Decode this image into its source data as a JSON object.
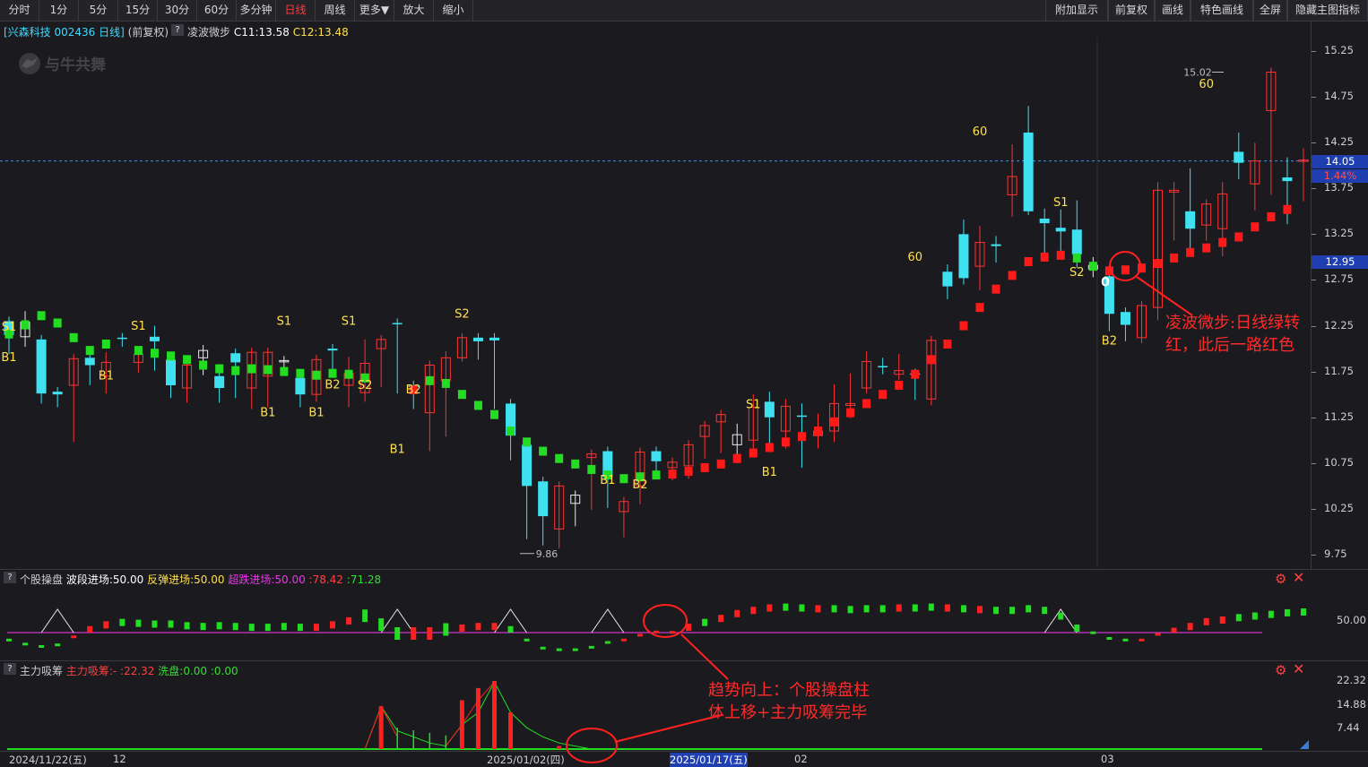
{
  "toolbar": {
    "left": [
      "分时",
      "1分",
      "5分",
      "15分",
      "30分",
      "60分",
      "多分钟",
      "日线",
      "周线",
      "更多▼",
      "放大",
      "缩小"
    ],
    "right": [
      "附加显示",
      "前复权",
      "画线",
      "特色画线",
      "全屏",
      "隐藏主图指标"
    ],
    "active": "日线"
  },
  "header": {
    "stock": "[兴森科技 002436 日线]",
    "adjust": "(前复权)",
    "q": "?",
    "indicator": "凌波微步",
    "c1": "C11:13.58",
    "c2": "C12:13.48"
  },
  "watermark": "与牛共舞",
  "price_axis": {
    "ticks": [
      "15.25",
      "14.75",
      "14.25",
      "13.75",
      "13.25",
      "12.75",
      "12.25",
      "11.75",
      "11.25",
      "10.75",
      "10.25",
      "9.75"
    ],
    "current_price": "14.05",
    "current_pct": "1.44%",
    "cursor_price": "12.95"
  },
  "chart_data": {
    "type": "candlestick",
    "ylim": [
      9.6,
      15.5
    ],
    "high_label": "15.02",
    "low_label": "9.86",
    "candles": [
      [
        12.3,
        12.15,
        12.05,
        11.98,
        "cyan"
      ],
      [
        12.13,
        12.29,
        12.36,
        12.06,
        "none"
      ],
      [
        12.1,
        11.51,
        11.65,
        11.44,
        "cyan"
      ],
      [
        11.5,
        11.53,
        11.44,
        11.4,
        "cyan"
      ],
      [
        11.6,
        11.89,
        11.86,
        11.02,
        "red"
      ],
      [
        11.9,
        11.82,
        11.88,
        11.64,
        "cyan"
      ],
      [
        11.7,
        11.85,
        11.91,
        11.55,
        "red"
      ],
      [
        12.12,
        12.11,
        12.11,
        12.06,
        "cyan"
      ],
      [
        11.85,
        11.94,
        11.94,
        11.78,
        "red"
      ],
      [
        12.13,
        12.08,
        12.2,
        11.8,
        "cyan"
      ],
      [
        11.88,
        11.6,
        11.77,
        11.5,
        "cyan"
      ],
      [
        11.57,
        11.82,
        11.86,
        11.45,
        "red"
      ],
      [
        11.9,
        11.98,
        11.99,
        11.75,
        "none"
      ],
      [
        11.7,
        11.57,
        11.64,
        11.45,
        "cyan"
      ],
      [
        11.95,
        11.85,
        11.81,
        11.5,
        "cyan"
      ],
      [
        11.57,
        11.96,
        11.93,
        11.38,
        "red"
      ],
      [
        11.7,
        11.96,
        11.92,
        11.4,
        "red"
      ],
      [
        11.87,
        11.86,
        11.86,
        11.8,
        "none"
      ],
      [
        11.5,
        11.68,
        11.72,
        11.4,
        "cyan"
      ],
      [
        11.5,
        11.88,
        11.86,
        11.46,
        "red"
      ],
      [
        12.0,
        11.98,
        11.98,
        11.75,
        "cyan"
      ],
      [
        11.6,
        11.73,
        11.86,
        11.4,
        "red"
      ],
      [
        11.52,
        11.84,
        12.05,
        11.46,
        "red"
      ],
      [
        12.0,
        12.1,
        12.09,
        11.62,
        "red"
      ],
      [
        12.27,
        12.28,
        12.04,
        11.55,
        "cyan"
      ],
      [
        11.58,
        11.6,
        11.52,
        11.38,
        "cyan"
      ],
      [
        11.3,
        11.82,
        11.76,
        10.92,
        "red"
      ],
      [
        11.65,
        11.9,
        11.92,
        11.08,
        "red"
      ],
      [
        11.9,
        12.12,
        12.1,
        12.0,
        "red"
      ],
      [
        12.08,
        12.12,
        12.08,
        11.92,
        "cyan"
      ],
      [
        12.12,
        12.09,
        12.09,
        11.38,
        "cyan"
      ],
      [
        11.4,
        11.05,
        11.02,
        10.82,
        "cyan"
      ],
      [
        10.95,
        10.5,
        10.52,
        9.96,
        "cyan"
      ],
      [
        10.55,
        10.17,
        10.0,
        9.89,
        "cyan"
      ],
      [
        10.5,
        10.03,
        10.45,
        9.86,
        "red"
      ],
      [
        10.4,
        10.31,
        10.32,
        10.1,
        "none"
      ],
      [
        10.85,
        10.81,
        10.81,
        10.28,
        "red"
      ],
      [
        10.6,
        10.88,
        10.62,
        10.3,
        "cyan"
      ],
      [
        10.22,
        10.33,
        10.13,
        9.98,
        "red"
      ],
      [
        10.5,
        10.87,
        10.79,
        10.34,
        "red"
      ],
      [
        10.88,
        10.77,
        10.72,
        10.64,
        "cyan"
      ],
      [
        10.7,
        10.76,
        10.72,
        10.6,
        "red"
      ],
      [
        10.95,
        10.72,
        10.92,
        10.62,
        "red"
      ],
      [
        11.16,
        11.04,
        11.05,
        10.84,
        "red"
      ],
      [
        11.2,
        11.28,
        11.28,
        10.9,
        "red"
      ],
      [
        10.95,
        11.06,
        11.13,
        10.79,
        "none"
      ],
      [
        11.0,
        11.36,
        11.45,
        10.95,
        "red"
      ],
      [
        11.25,
        11.42,
        11.48,
        11.0,
        "cyan"
      ],
      [
        11.1,
        11.37,
        11.4,
        10.95,
        "red"
      ],
      [
        11.26,
        11.27,
        11.35,
        10.74,
        "cyan"
      ],
      [
        11.1,
        11.05,
        11.24,
        10.95,
        "red"
      ],
      [
        11.1,
        11.4,
        11.56,
        11.02,
        "red"
      ],
      [
        11.4,
        11.38,
        11.68,
        11.28,
        "red"
      ],
      [
        11.57,
        11.86,
        11.92,
        11.55,
        "red"
      ],
      [
        11.8,
        11.81,
        11.85,
        11.76,
        "cyan"
      ],
      [
        11.76,
        11.72,
        11.89,
        11.7,
        "red"
      ],
      [
        11.73,
        11.73,
        11.73,
        11.48,
        "cyan"
      ],
      [
        11.45,
        12.09,
        12.09,
        11.42,
        "red"
      ],
      [
        12.68,
        12.84,
        12.87,
        12.58,
        "cyan"
      ],
      [
        12.77,
        13.25,
        13.36,
        12.74,
        "cyan"
      ],
      [
        12.9,
        13.16,
        13.29,
        12.68,
        "red"
      ],
      [
        13.12,
        13.14,
        13.18,
        12.98,
        "cyan"
      ],
      [
        13.68,
        13.88,
        14.18,
        13.48,
        "red"
      ],
      [
        13.5,
        14.36,
        14.6,
        13.78,
        "cyan"
      ],
      [
        13.42,
        13.37,
        13.48,
        13.05,
        "cyan"
      ],
      [
        13.28,
        13.32,
        13.47,
        13.09,
        "cyan"
      ],
      [
        13.3,
        13.03,
        13.57,
        12.92,
        "cyan"
      ],
      [
        12.87,
        12.91,
        12.95,
        12.82,
        "none"
      ],
      [
        12.79,
        12.38,
        12.43,
        12.23,
        "cyan"
      ],
      [
        12.4,
        12.26,
        12.3,
        12.12,
        "cyan"
      ],
      [
        12.12,
        12.47,
        12.44,
        12.1,
        "red"
      ],
      [
        12.45,
        13.73,
        13.77,
        12.35,
        "red"
      ],
      [
        13.73,
        13.71,
        13.77,
        13.22,
        "red"
      ],
      [
        13.5,
        13.31,
        13.92,
        13.05,
        "cyan"
      ],
      [
        13.58,
        13.35,
        13.46,
        13.22,
        "red"
      ],
      [
        13.31,
        13.69,
        13.77,
        13.05,
        "red"
      ],
      [
        14.15,
        14.03,
        14.31,
        13.89,
        "cyan"
      ],
      [
        13.8,
        14.05,
        14.2,
        13.55,
        "red"
      ],
      [
        14.6,
        15.02,
        15.02,
        13.72,
        "red"
      ],
      [
        13.83,
        13.87,
        14.04,
        13.4,
        "cyan"
      ],
      [
        14.05,
        14.06,
        14.14,
        13.65,
        "red"
      ]
    ],
    "trail": [
      [
        0,
        12.16,
        "green"
      ],
      [
        1,
        12.26,
        "green"
      ],
      [
        2,
        12.36,
        "green"
      ],
      [
        3,
        12.28,
        "green"
      ],
      [
        4,
        12.12,
        "green"
      ],
      [
        5,
        11.98,
        "green"
      ],
      [
        6,
        12.05,
        "green"
      ],
      [
        8,
        11.98,
        "green"
      ],
      [
        9,
        11.95,
        "green"
      ],
      [
        10,
        11.92,
        "green"
      ],
      [
        11,
        11.88,
        "green"
      ],
      [
        12,
        11.82,
        "green"
      ],
      [
        13,
        11.78,
        "green"
      ],
      [
        14,
        11.76,
        "green"
      ],
      [
        15,
        11.78,
        "green"
      ],
      [
        16,
        11.77,
        "green"
      ],
      [
        17,
        11.75,
        "green"
      ],
      [
        18,
        11.73,
        "green"
      ],
      [
        19,
        11.71,
        "green"
      ],
      [
        20,
        11.73,
        "green"
      ],
      [
        21,
        11.72,
        "green"
      ],
      [
        22,
        11.68,
        "green"
      ],
      [
        25,
        11.55,
        "red"
      ],
      [
        26,
        11.65,
        "green"
      ],
      [
        27,
        11.62,
        "green"
      ],
      [
        28,
        11.5,
        "green"
      ],
      [
        29,
        11.38,
        "green"
      ],
      [
        30,
        11.28,
        "green"
      ],
      [
        31,
        11.1,
        "green"
      ],
      [
        32,
        10.98,
        "green"
      ],
      [
        33,
        10.88,
        "green"
      ],
      [
        34,
        10.8,
        "green"
      ],
      [
        35,
        10.74,
        "green"
      ],
      [
        36,
        10.68,
        "green"
      ],
      [
        37,
        10.62,
        "green"
      ],
      [
        38,
        10.58,
        "green"
      ],
      [
        39,
        10.6,
        "green"
      ],
      [
        40,
        10.62,
        "green"
      ],
      [
        41,
        10.63,
        "red"
      ],
      [
        42,
        10.66,
        "red"
      ],
      [
        43,
        10.7,
        "red"
      ],
      [
        44,
        10.74,
        "red"
      ],
      [
        45,
        10.8,
        "red"
      ],
      [
        46,
        10.86,
        "red"
      ],
      [
        47,
        10.92,
        "red"
      ],
      [
        48,
        10.98,
        "red"
      ],
      [
        49,
        11.04,
        "red"
      ],
      [
        50,
        11.1,
        "red"
      ],
      [
        51,
        11.2,
        "red"
      ],
      [
        52,
        11.3,
        "red"
      ],
      [
        53,
        11.4,
        "red"
      ],
      [
        54,
        11.5,
        "red"
      ],
      [
        55,
        11.6,
        "red"
      ],
      [
        56,
        11.72,
        "red"
      ],
      [
        57,
        11.88,
        "red"
      ],
      [
        58,
        12.05,
        "red"
      ],
      [
        59,
        12.25,
        "red"
      ],
      [
        60,
        12.45,
        "red"
      ],
      [
        61,
        12.65,
        "red"
      ],
      [
        62,
        12.8,
        "red"
      ],
      [
        63,
        12.95,
        "red"
      ],
      [
        64,
        13.0,
        "red"
      ],
      [
        65,
        13.02,
        "red"
      ],
      [
        66,
        12.99,
        "green"
      ],
      [
        67,
        12.9,
        "green"
      ],
      [
        68,
        12.85,
        "red"
      ],
      [
        69,
        12.86,
        "red"
      ],
      [
        70,
        12.88,
        "red"
      ],
      [
        71,
        12.93,
        "red"
      ],
      [
        72,
        12.99,
        "red"
      ],
      [
        73,
        13.05,
        "red"
      ],
      [
        74,
        13.1,
        "red"
      ],
      [
        75,
        13.16,
        "red"
      ],
      [
        76,
        13.22,
        "red"
      ],
      [
        77,
        13.33,
        "red"
      ],
      [
        78,
        13.44,
        "red"
      ],
      [
        79,
        13.52,
        "red"
      ]
    ],
    "marks": [
      [
        0,
        "S1",
        12.14,
        "above"
      ],
      [
        0,
        "B1",
        12.0,
        "below"
      ],
      [
        8,
        "S1",
        12.15,
        "above"
      ],
      [
        6,
        "B1",
        11.8,
        "below"
      ],
      [
        17,
        "S1",
        12.2,
        "above"
      ],
      [
        16,
        "B1",
        11.4,
        "below"
      ],
      [
        21,
        "S1",
        12.2,
        "above"
      ],
      [
        19,
        "B1",
        11.4,
        "below"
      ],
      [
        20,
        "B2",
        11.7,
        "below"
      ],
      [
        22,
        "S2",
        11.5,
        "above"
      ],
      [
        24,
        "B1",
        11.0,
        "below"
      ],
      [
        25,
        "B2",
        11.65,
        "below"
      ],
      [
        28,
        "S2",
        12.28,
        "above"
      ],
      [
        37,
        "B1",
        10.66,
        "below"
      ],
      [
        39,
        "B2",
        10.61,
        "below"
      ],
      [
        46,
        "S1",
        11.29,
        "above"
      ],
      [
        47,
        "B1",
        10.75,
        "below"
      ],
      [
        56,
        "60",
        12.9,
        "above"
      ],
      [
        60,
        "60",
        14.27,
        "above"
      ],
      [
        65,
        "S1",
        13.5,
        "above"
      ],
      [
        66,
        "S2",
        12.93,
        "below"
      ],
      [
        68,
        "B2",
        12.18,
        "below"
      ],
      [
        74,
        "60",
        14.79,
        "above"
      ]
    ],
    "x_labels": [
      "2024/11/22(五)",
      "12",
      "2025/01/02(四)",
      "2025/01/17(五)",
      "02",
      "03"
    ]
  },
  "panel2": {
    "q": "?",
    "name": "个股操盘",
    "l1": "波段进场:50.00",
    "l2": "反弹进场:50.00",
    "l3": "超跌进场:50.00",
    "v1": ":78.42",
    "v2": ":71.28",
    "axis": "50.00",
    "series": [
      38,
      33,
      30,
      32,
      42,
      58,
      64,
      67,
      66,
      65,
      65,
      63,
      62,
      63,
      62,
      61,
      61,
      62,
      61,
      61,
      64,
      69,
      72,
      61,
      50,
      48,
      45,
      55,
      60,
      62,
      62,
      58,
      38,
      28,
      26,
      26,
      29,
      35,
      38,
      44,
      48,
      52,
      61,
      67,
      72,
      78,
      82,
      85,
      86,
      85,
      84,
      84,
      83,
      84,
      84,
      85,
      85,
      86,
      85,
      84,
      83,
      82,
      82,
      84,
      82,
      75,
      60,
      47,
      40,
      38,
      38,
      45,
      56,
      62,
      68,
      70,
      73,
      75,
      77,
      79,
      80
    ],
    "colors": [
      "g",
      "g",
      "g",
      "g",
      "r",
      "r",
      "r",
      "g",
      "g",
      "g",
      "g",
      "g",
      "g",
      "g",
      "g",
      "g",
      "g",
      "g",
      "g",
      "r",
      "r",
      "r",
      "g",
      "g",
      "g",
      "r",
      "r",
      "g",
      "r",
      "r",
      "r",
      "g",
      "g",
      "g",
      "g",
      "g",
      "g",
      "g",
      "r",
      "r",
      "r",
      "r",
      "r",
      "g",
      "r",
      "r",
      "r",
      "r",
      "g",
      "g",
      "r",
      "g",
      "g",
      "g",
      "g",
      "r",
      "g",
      "g",
      "r",
      "g",
      "r",
      "g",
      "g",
      "g",
      "g",
      "g",
      "g",
      "g",
      "g",
      "g",
      "r",
      "r",
      "r",
      "r",
      "r",
      "r",
      "g",
      "g",
      "g",
      "g",
      "g"
    ],
    "triangles": [
      3,
      24,
      31,
      37,
      65
    ]
  },
  "panel3": {
    "q": "?",
    "name": "主力吸筹",
    "l1": "主力吸筹:-",
    "v1": ":22.32",
    "l2": "洗盘:0.00",
    "v2": ":0.00",
    "axis": [
      "22.32",
      "14.88",
      "7.44"
    ],
    "bars": [
      [
        23,
        14
      ],
      [
        28,
        16
      ],
      [
        29,
        20
      ],
      [
        30,
        22.32
      ],
      [
        31,
        12
      ],
      [
        34,
        1
      ]
    ],
    "line": [
      [
        22,
        0
      ],
      [
        23,
        14
      ],
      [
        24,
        6
      ],
      [
        25,
        4
      ],
      [
        26,
        2
      ],
      [
        27,
        1
      ],
      [
        28,
        8
      ],
      [
        29,
        12
      ],
      [
        30,
        22
      ],
      [
        31,
        12
      ],
      [
        32,
        7
      ],
      [
        33,
        4
      ],
      [
        34,
        2
      ],
      [
        35,
        1
      ],
      [
        36,
        0
      ]
    ]
  },
  "annotations": {
    "a1_l1": "凌波微步:日线绿转",
    "a1_l2": "红，此后一路红色",
    "a2_l1": "趋势向上：个股操盘柱",
    "a2_l2": "体上移+主力吸筹完毕"
  },
  "colors": {
    "up": "#ff3232",
    "down": "#3fe0f0",
    "green": "#22dd22",
    "purple": "#cc33cc",
    "label": "#ffe04a",
    "annotation": "#ff2a2a"
  }
}
